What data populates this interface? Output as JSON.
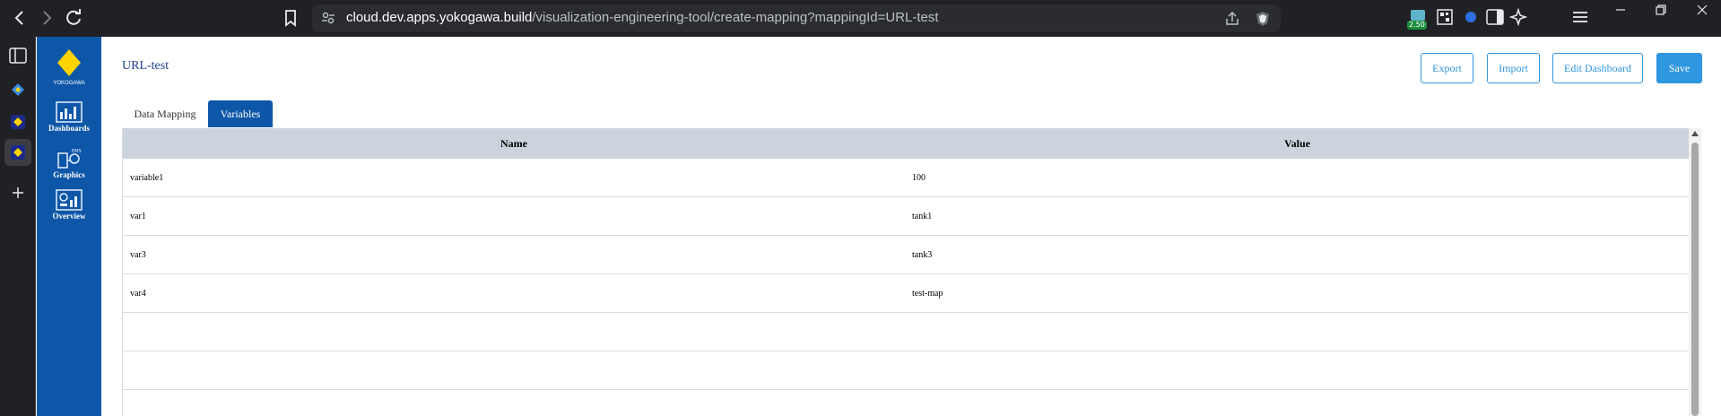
{
  "browser": {
    "url_domain": "cloud.dev.apps.yokogawa.build",
    "url_path": "/visualization-engineering-tool/create-mapping?mappingId=URL-test",
    "extension_badge": "2.50"
  },
  "sidebar": {
    "logo_text": "YOKOGAWA",
    "items": [
      {
        "label": "Dashboards",
        "icon": "dashboards-icon"
      },
      {
        "label": "Graphics",
        "icon": "graphics-icon"
      },
      {
        "label": "Overview",
        "icon": "overview-icon"
      }
    ]
  },
  "page": {
    "title": "URL-test"
  },
  "toolbar": {
    "export_label": "Export",
    "import_label": "Import",
    "edit_dashboard_label": "Edit Dashboard",
    "save_label": "Save"
  },
  "tabs": [
    {
      "label": "Data Mapping",
      "active": false
    },
    {
      "label": "Variables",
      "active": true
    }
  ],
  "table": {
    "columns": [
      "Name",
      "Value"
    ],
    "rows": [
      {
        "name": "variable1",
        "value": "100"
      },
      {
        "name": "var1",
        "value": "tank1"
      },
      {
        "name": "var3",
        "value": "tank3"
      },
      {
        "name": "var4",
        "value": "test-map"
      },
      {
        "name": "",
        "value": ""
      },
      {
        "name": "",
        "value": ""
      }
    ]
  },
  "colors": {
    "brand_blue": "#0e56a8",
    "accent_blue": "#2f96e0",
    "header_gray": "#cbd3dc",
    "logo_yellow": "#ffd400"
  }
}
